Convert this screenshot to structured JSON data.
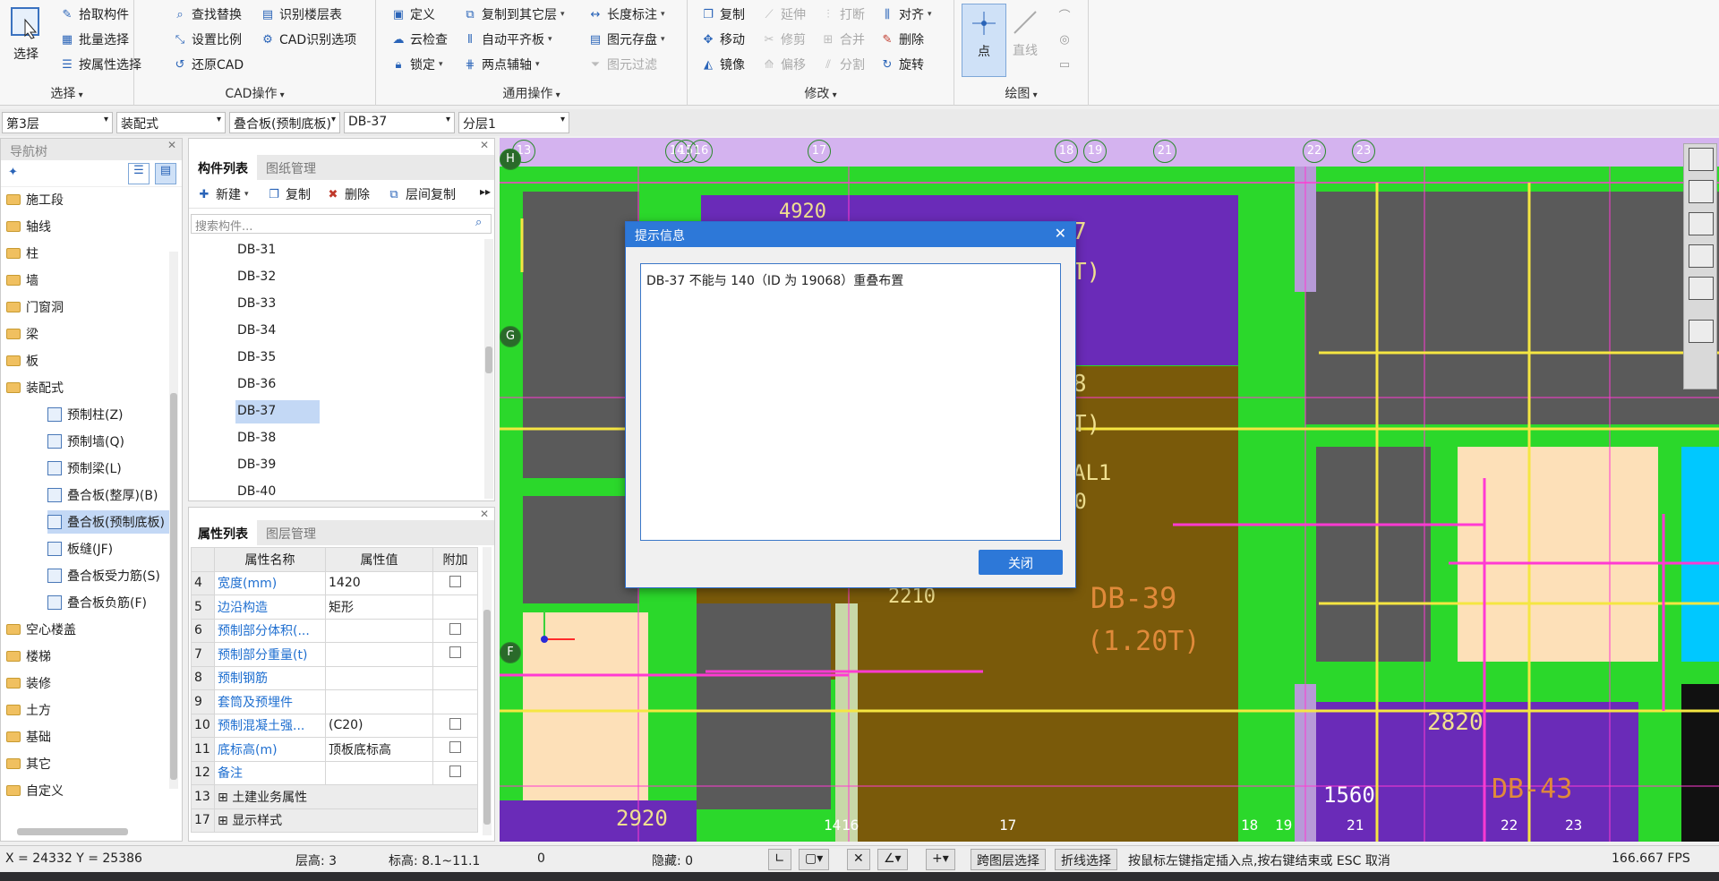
{
  "ribbon": {
    "select_group": {
      "big": "选择",
      "items": [
        "拾取构件",
        "批量选择",
        "按属性选择"
      ],
      "title": "选择"
    },
    "cad_group": {
      "items": [
        "查找替换",
        "识别楼层表",
        "设置比例",
        "CAD识别选项",
        "还原CAD"
      ],
      "title": "CAD操作"
    },
    "common_group": {
      "items": [
        "定义",
        "复制到其它层",
        "长度标注",
        "云检查",
        "自动平齐板",
        "图元存盘",
        "锁定",
        "两点辅轴",
        "图元过滤"
      ],
      "title": "通用操作"
    },
    "modify_group": {
      "items": [
        "复制",
        "延伸",
        "打断",
        "对齐",
        "移动",
        "修剪",
        "合并",
        "删除",
        "镜像",
        "偏移",
        "分割",
        "旋转"
      ],
      "title": "修改"
    },
    "draw_group": {
      "point": "点",
      "line": "直线",
      "title": "绘图"
    }
  },
  "selectors": [
    "第3层",
    "装配式",
    "叠合板(预制底板)",
    "DB-37",
    "分层1"
  ],
  "nav": {
    "title": "导航树",
    "items": [
      "施工段",
      "轴线",
      "柱",
      "墙",
      "门窗洞",
      "梁",
      "板",
      "装配式",
      "预制柱(Z)",
      "预制墙(Q)",
      "预制梁(L)",
      "叠合板(整厚)(B)",
      "叠合板(预制底板)",
      "板缝(JF)",
      "叠合板受力筋(S)",
      "叠合板负筋(F)",
      "空心楼盖",
      "楼梯",
      "装修",
      "土方",
      "基础",
      "其它",
      "自定义"
    ]
  },
  "components": {
    "tabs": [
      "构件列表",
      "图纸管理"
    ],
    "toolbar": [
      "新建",
      "复制",
      "删除",
      "层间复制"
    ],
    "search_placeholder": "搜索构件...",
    "items": [
      "DB-31",
      "DB-32",
      "DB-33",
      "DB-34",
      "DB-35",
      "DB-36",
      "DB-37",
      "DB-38",
      "DB-39",
      "DB-40"
    ],
    "selected": "DB-37"
  },
  "properties": {
    "tabs": [
      "属性列表",
      "图层管理"
    ],
    "headers": [
      "属性名称",
      "属性值",
      "附加"
    ],
    "rows": [
      {
        "no": "4",
        "name": "宽度(mm)",
        "value": "1420"
      },
      {
        "no": "5",
        "name": "边沿构造",
        "value": "矩形"
      },
      {
        "no": "6",
        "name": "预制部分体积(...",
        "value": ""
      },
      {
        "no": "7",
        "name": "预制部分重量(t)",
        "value": ""
      },
      {
        "no": "8",
        "name": "预制钢筋",
        "value": ""
      },
      {
        "no": "9",
        "name": "套筒及预埋件",
        "value": ""
      },
      {
        "no": "10",
        "name": "预制混凝土强...",
        "value": "(C20)"
      },
      {
        "no": "11",
        "name": "底标高(m)",
        "value": "顶板底标高"
      },
      {
        "no": "12",
        "name": "备注",
        "value": ""
      },
      {
        "no": "13",
        "name": "土建业务属性",
        "value": ""
      },
      {
        "no": "17",
        "name": "显示样式",
        "value": ""
      }
    ]
  },
  "canvas": {
    "axes_top": [
      "13",
      "14",
      "15",
      "16",
      "17",
      "18",
      "19",
      "21",
      "22",
      "23"
    ],
    "axes_left": [
      "H",
      "G",
      "F"
    ],
    "labels": [
      "4920",
      "7",
      "T)",
      "8",
      "T)",
      "AL1",
      "3620",
      "2210",
      "DB-39",
      "(1.20T)",
      "2820",
      "DB-43",
      "2920",
      "1560",
      "14",
      "16",
      "17",
      "18",
      "19",
      "21",
      "22",
      "23"
    ],
    "colors": {
      "background": "#1a1a1a",
      "wall": "#2bd82b",
      "slab_purple": "#6a2bb8",
      "slab_brown": "#7a5a0a",
      "slab_peach": "#fde0b8",
      "slab_gray": "#5a5a5a",
      "rebar_yellow": "#f5e642",
      "rebar_magenta": "#ff3ad2",
      "top_band": "#d4b3ef"
    }
  },
  "dialog": {
    "title": "提示信息",
    "message": "DB-37 不能与 140（ID 为 19068）重叠布置",
    "button": "关闭"
  },
  "status": {
    "coords": "X = 24332 Y = 25386",
    "floor_height": "层高:  3",
    "elevation": "标高:  8.1~11.1",
    "zero": "0",
    "hidden": "隐藏:  0",
    "cross_layer": "跨图层选择",
    "polyline": "折线选择",
    "hint": "按鼠标左键指定插入点,按右键结束或 ESC 取消",
    "fps": "166.667 FPS"
  }
}
